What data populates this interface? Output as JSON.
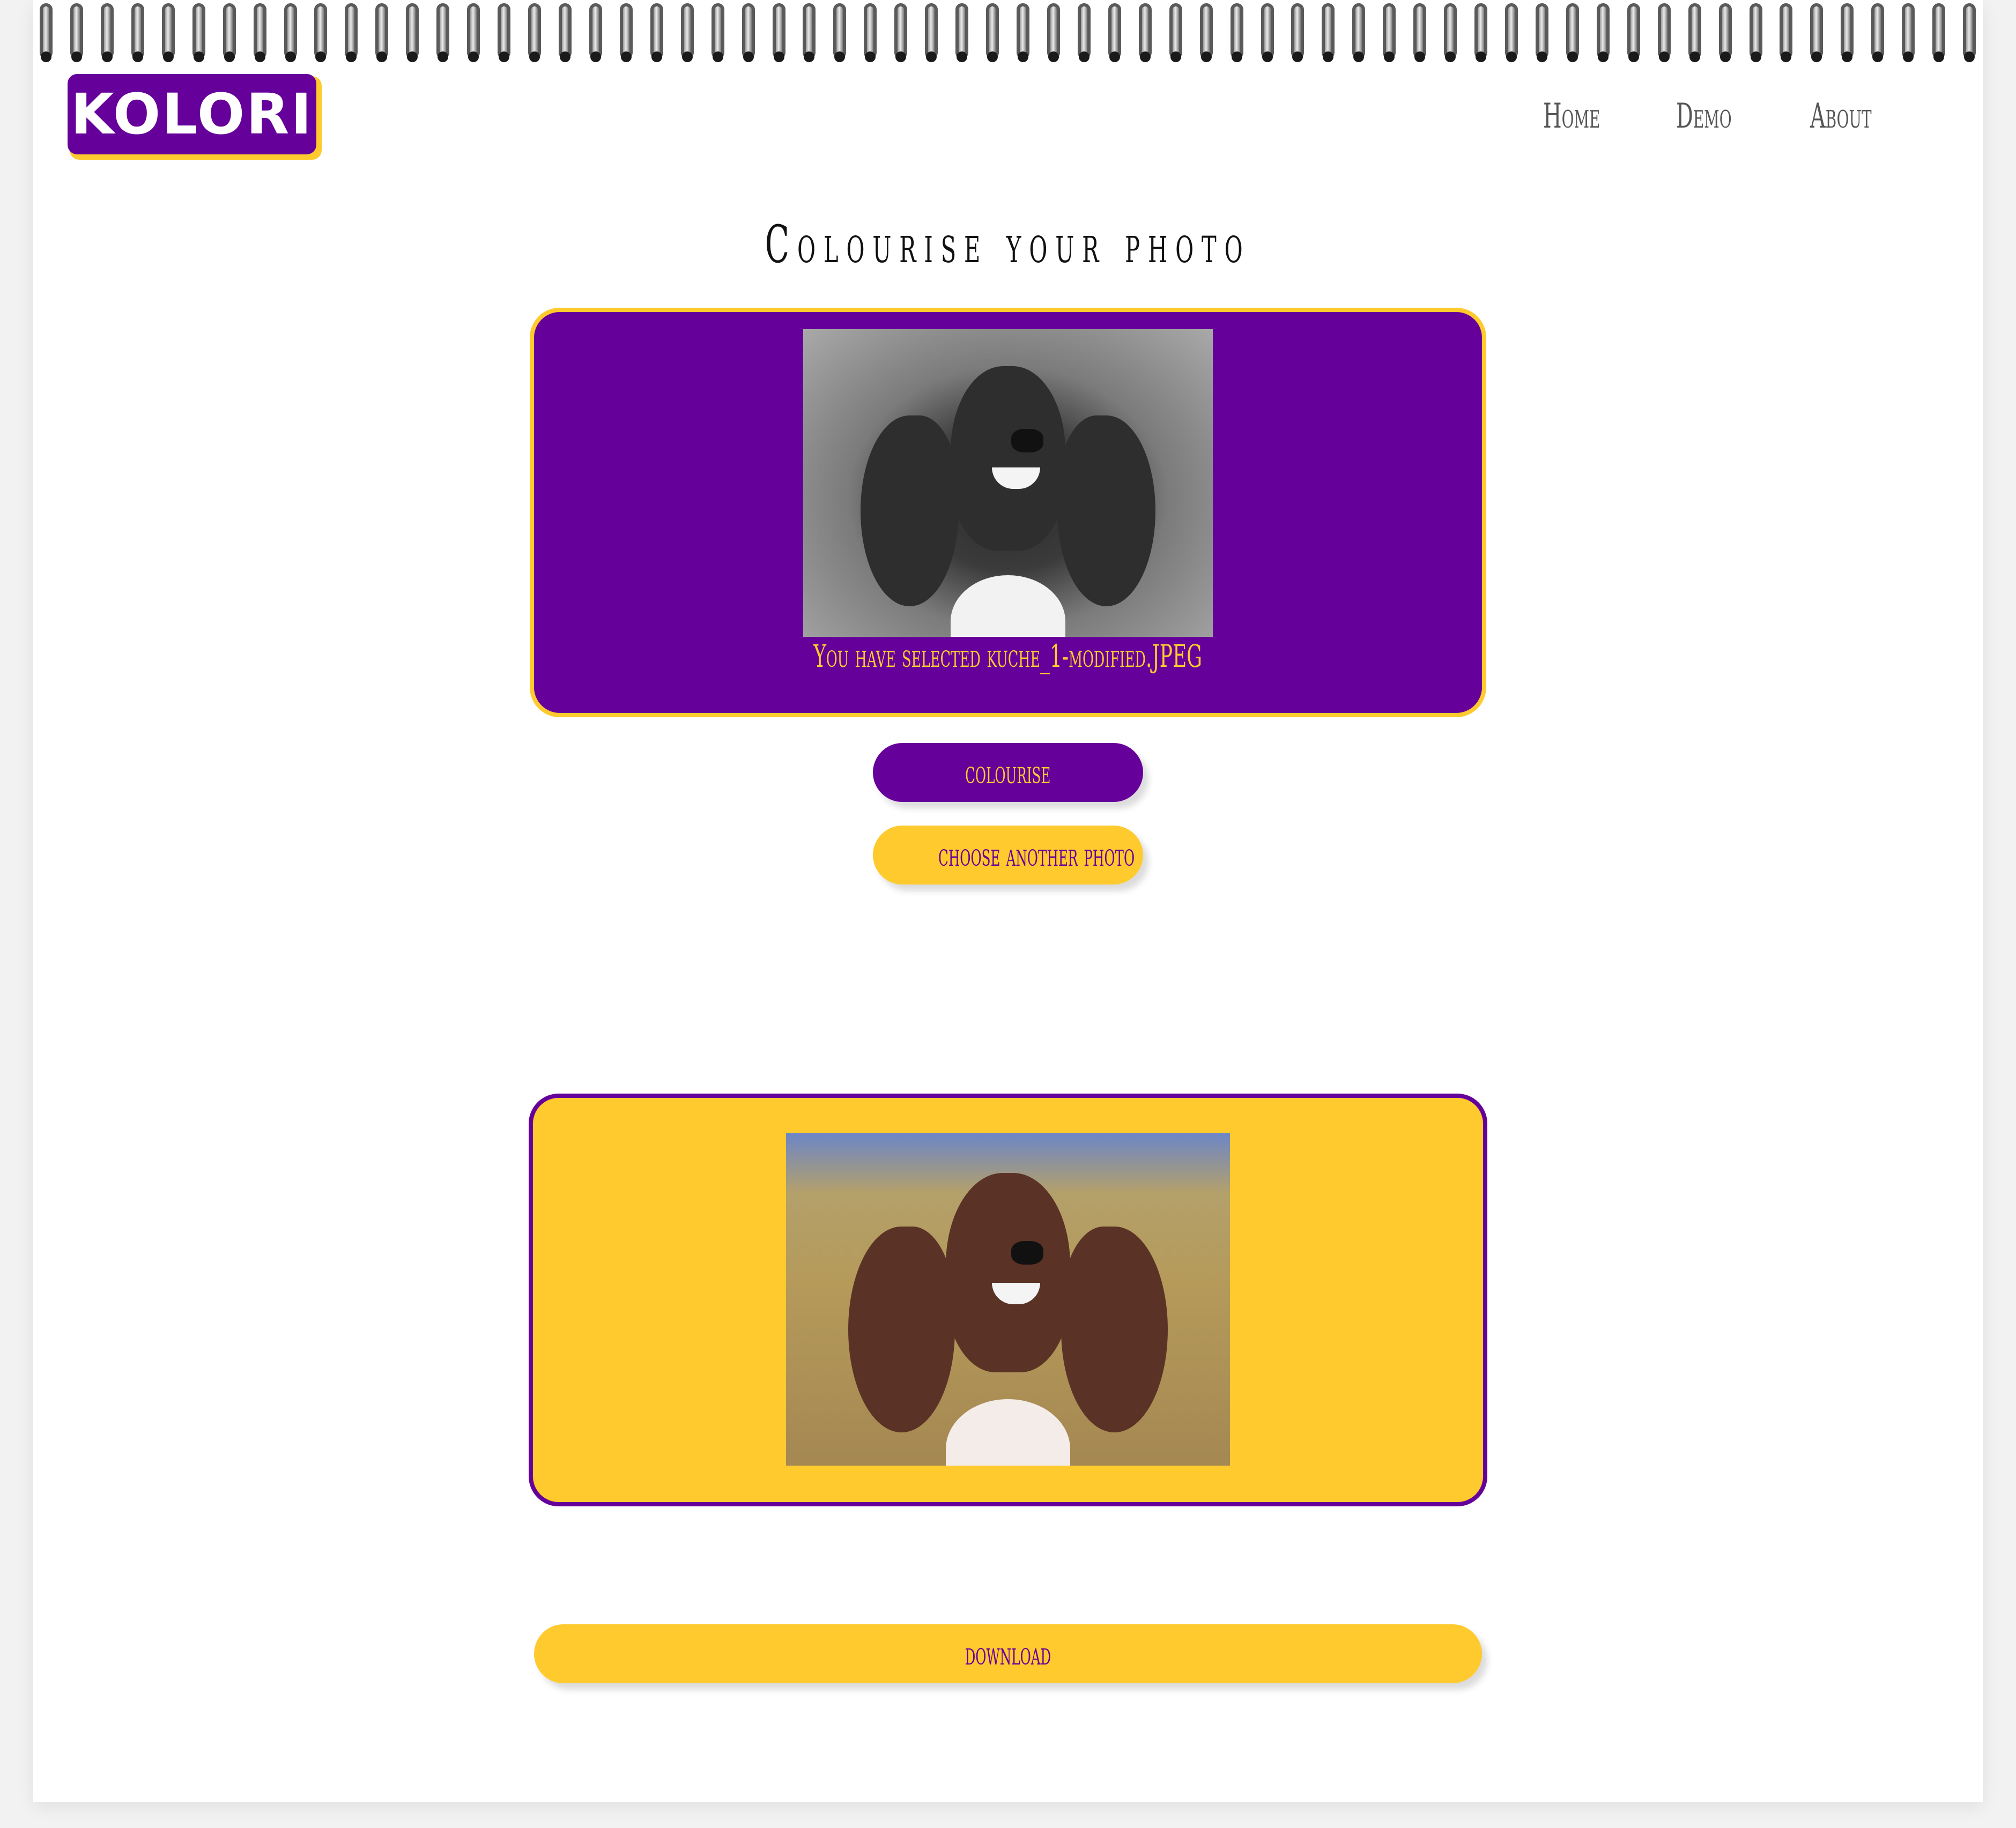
{
  "logo": {
    "text": "KOLORI"
  },
  "nav": {
    "home": "Home",
    "demo": "Demo",
    "about": "About"
  },
  "page": {
    "title": "Colourise your photo"
  },
  "input_card": {
    "image_alt": "black and white dog photo",
    "selected_text": "You have selected kuche_1-modified.JPEG"
  },
  "buttons": {
    "colourise": "colourise",
    "choose_another": "choose another photo",
    "download": "download"
  },
  "output_card": {
    "image_alt": "colourised dog photo"
  },
  "colors": {
    "purple": "#66009a",
    "yellow": "#ffca2e"
  }
}
